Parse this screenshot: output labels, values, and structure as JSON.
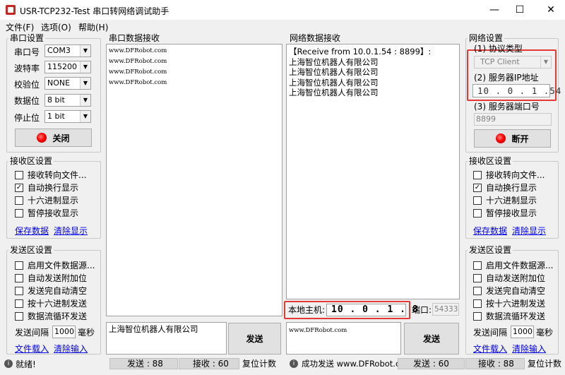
{
  "window": {
    "title": "USR-TCP232-Test 串口转网络调试助手",
    "minimize": "—",
    "maximize": "☐",
    "close": "✕"
  },
  "menu": [
    "文件(F)",
    "选项(O)",
    "帮助(H)"
  ],
  "serial_settings": {
    "title": "串口设置",
    "port_label": "串口号",
    "port_value": "COM3",
    "baud_label": "波特率",
    "baud_value": "115200",
    "parity_label": "校验位",
    "parity_value": "NONE",
    "databits_label": "数据位",
    "databits_value": "8 bit",
    "stopbits_label": "停止位",
    "stopbits_value": "1 bit",
    "close_button": "关闭"
  },
  "left_recv_settings": {
    "title": "接收区设置",
    "options": [
      {
        "label": "接收转向文件...",
        "checked": false
      },
      {
        "label": "自动换行显示",
        "checked": true
      },
      {
        "label": "十六进制显示",
        "checked": false
      },
      {
        "label": "暂停接收显示",
        "checked": false
      }
    ],
    "save_link": "保存数据",
    "clear_link": "清除显示"
  },
  "left_send_settings": {
    "title": "发送区设置",
    "options": [
      {
        "label": "启用文件数据源...",
        "checked": false
      },
      {
        "label": "自动发送附加位",
        "checked": false
      },
      {
        "label": "发送完自动清空",
        "checked": false
      },
      {
        "label": "按十六进制发送",
        "checked": false
      },
      {
        "label": "数据流循环发送",
        "checked": false
      }
    ],
    "interval_label": "发送间隔",
    "interval_value": "1000",
    "interval_unit": "毫秒",
    "load_link": "文件载入",
    "clear_link": "清除输入"
  },
  "serial_recv": {
    "title": "串口数据接收",
    "lines": [
      "www.DFRobot.com",
      "www.DFRobot.com",
      "www.DFRobot.com",
      "www.DFRobot.com"
    ]
  },
  "serial_send": {
    "text": "上海智位机器人有限公司",
    "send_button": "发送"
  },
  "net_recv": {
    "title": "网络数据接收",
    "lines": [
      "【Receive from 10.0.1.54 : 8899】:",
      "上海智位机器人有限公司",
      "上海智位机器人有限公司",
      "上海智位机器人有限公司",
      "上海智位机器人有限公司"
    ]
  },
  "local_host": {
    "label": "本地主机:",
    "ip": "10 . 0 . 1 . 8",
    "port_label": "端口:",
    "port_value": "54333"
  },
  "net_send": {
    "text": "www.DFRobot.com",
    "send_button": "发送"
  },
  "net_settings": {
    "title": "网络设置",
    "protocol_label": "(1) 协议类型",
    "protocol_value": "TCP Client",
    "server_ip_label": "(2) 服务器IP地址",
    "server_ip": "10 . 0 . 1 .54",
    "server_port_label": "(3) 服务器端口号",
    "server_port": "8899",
    "open_button": "断开"
  },
  "right_recv_settings": {
    "title": "接收区设置",
    "options": [
      {
        "label": "接收转向文件...",
        "checked": false
      },
      {
        "label": "自动换行显示",
        "checked": true
      },
      {
        "label": "十六进制显示",
        "checked": false
      },
      {
        "label": "暂停接收显示",
        "checked": false
      }
    ],
    "save_link": "保存数据",
    "clear_link": "清除显示"
  },
  "right_send_settings": {
    "title": "发送区设置",
    "options": [
      {
        "label": "启用文件数据源...",
        "checked": false
      },
      {
        "label": "自动发送附加位",
        "checked": false
      },
      {
        "label": "发送完自动清空",
        "checked": false
      },
      {
        "label": "按十六进制发送",
        "checked": false
      },
      {
        "label": "数据流循环发送",
        "checked": false
      }
    ],
    "interval_label": "发送间隔",
    "interval_value": "1000",
    "interval_unit": "毫秒",
    "load_link": "文件载入",
    "clear_link": "清除输入"
  },
  "status": {
    "left_status": "就绪!",
    "left_sent": "发送 : 88",
    "left_recv": "接收 : 60",
    "left_reset": "复位计数",
    "right_status": "成功发送 www.DFRobot.com",
    "right_sent": "发送 : 60",
    "right_recv": "接收 : 88",
    "right_reset": "复位计数"
  },
  "colors": {
    "highlight_box": "#e53935",
    "link": "#0000ee",
    "led": "#ff0000"
  }
}
